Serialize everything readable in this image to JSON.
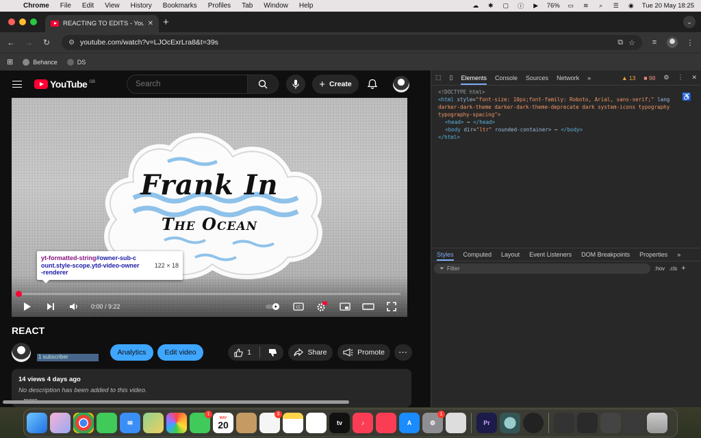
{
  "menubar": {
    "app_name": "Chrome",
    "items": [
      "File",
      "Edit",
      "View",
      "History",
      "Bookmarks",
      "Profiles",
      "Tab",
      "Window",
      "Help"
    ],
    "battery": "76%",
    "datetime": "Tue 20 May  18:25"
  },
  "browser": {
    "tab_title": "REACTING TO EDITS - YouTub",
    "url": "youtube.com/watch?v=LJOcExrLra8&t=39s",
    "bookmarks": [
      "Behance",
      "DS"
    ]
  },
  "youtube": {
    "logo_text": "YouTube",
    "region": "GB",
    "search_placeholder": "Search",
    "create_label": "Create",
    "video_art_line1": "Frank In",
    "video_art_line2": "The Ocean",
    "time_display": "0:00 / 9:22",
    "progress_fraction": 0.0,
    "video_title": "REACT",
    "subscriber_text": "1 subscriber",
    "analytics_label": "Analytics",
    "edit_video_label": "Edit video",
    "like_count": "1",
    "share_label": "Share",
    "promote_label": "Promote",
    "description_meta": "14 views  4 days ago",
    "description_text": "No description has been added to this video.",
    "more_label": "...more"
  },
  "inspector_tooltip": {
    "tag": "yt-formatted-string",
    "selector_line1": "#owner-sub-c",
    "selector_line2": "ount.style-scope.ytd-video-owner",
    "selector_line3": "-renderer",
    "size": "122 × 18"
  },
  "devtools": {
    "tabs": [
      "Elements",
      "Console",
      "Sources",
      "Network"
    ],
    "warnings": "13",
    "errors": "98",
    "dom": {
      "doctype": "<!DOCTYPE html>",
      "html_open_tag": "<html",
      "html_attr_style": "style",
      "html_style_value": "\"font-size: 10px;font-family: Roboto, Arial, sans-serif;\"",
      "html_attr_lang": "lang",
      "html_class_line1": "darker-dark-theme darker-dark-theme-deprecate dark system-icons typography",
      "html_class_line2": "typography-spacing\">",
      "head": "<head>",
      "head_close": "</head>",
      "body_open": "<body",
      "body_attr_dir": "dir",
      "body_dir_value": "\"ltr\"",
      "body_attr_rounded": "rounded-container>",
      "body_close": "</body>",
      "html_close": "</html>"
    },
    "styles_tabs": [
      "Styles",
      "Computed",
      "Layout",
      "Event Listeners",
      "DOM Breakpoints",
      "Properties"
    ],
    "filter_placeholder": "Filter",
    "hov_label": ":hov",
    "cls_label": ".cls"
  },
  "dock": {
    "calendar_month": "MAY",
    "calendar_day": "20",
    "badges": {
      "messages": "1",
      "reminders": "3",
      "settings": "1"
    },
    "premiere_label": "Pr",
    "tv_label": "tv"
  },
  "colors": {
    "youtube_red": "#ff0033",
    "action_blue": "#3ea6ff",
    "devtools_accent": "#7cacf8"
  }
}
